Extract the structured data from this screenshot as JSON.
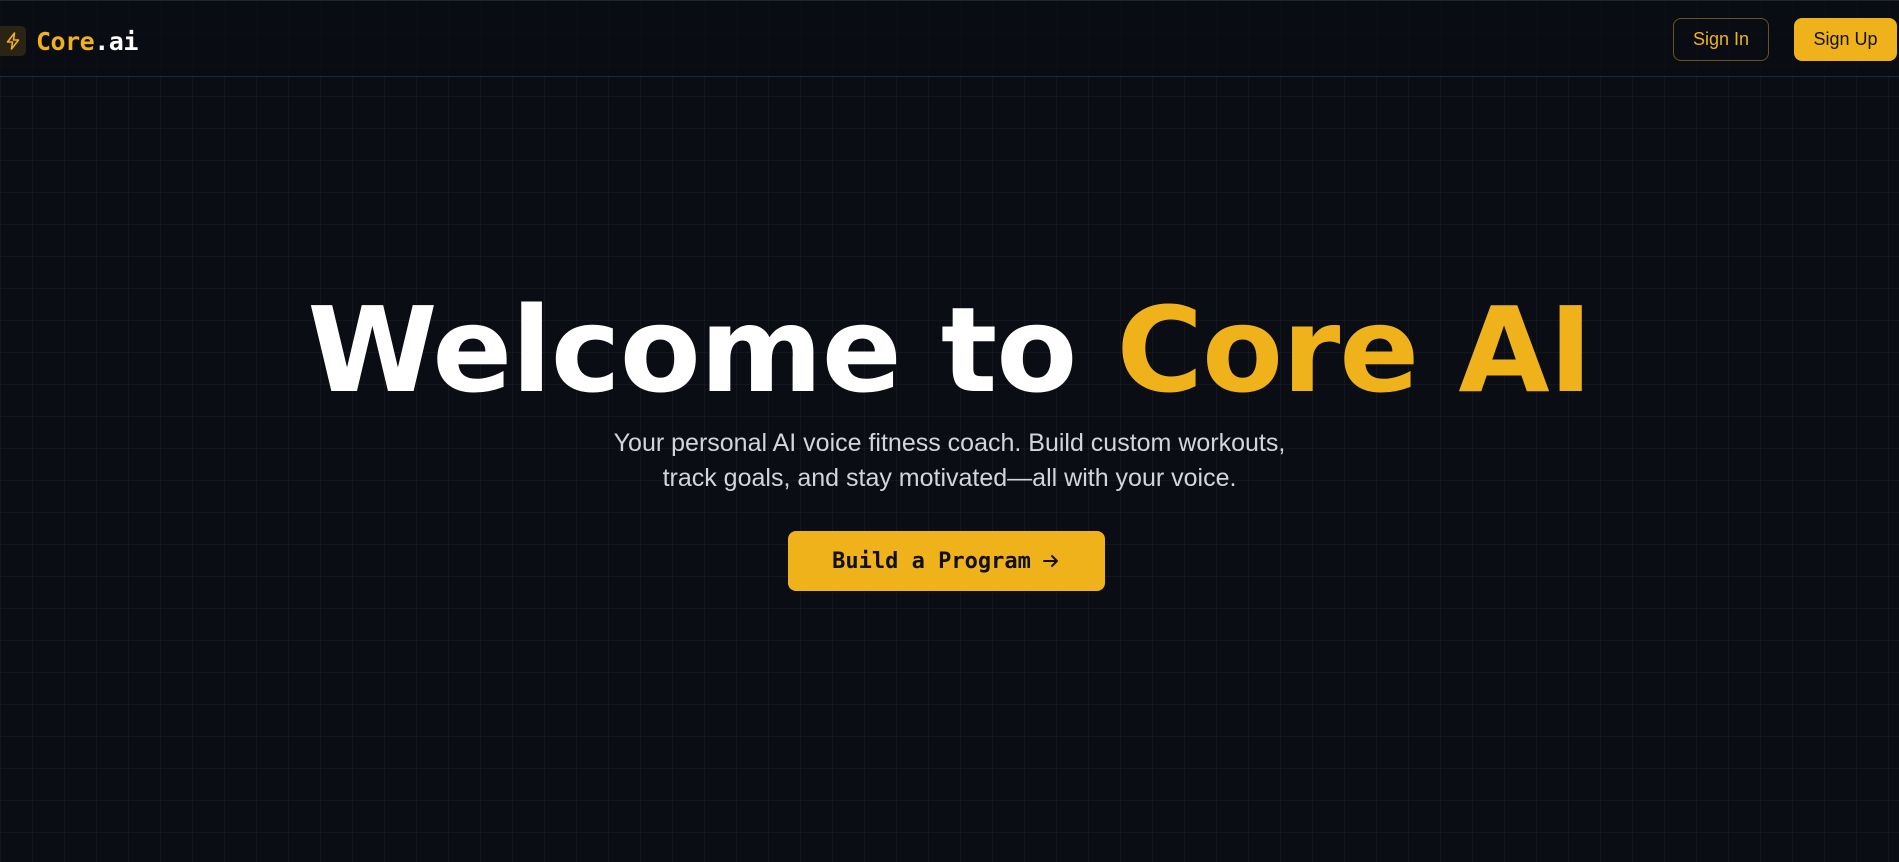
{
  "header": {
    "logo": {
      "icon": "lightning-bolt-icon",
      "brand_primary": "Core",
      "brand_suffix": ".ai"
    },
    "sign_in_label": "Sign In",
    "sign_up_label": "Sign Up"
  },
  "hero": {
    "title_prefix": "Welcome to",
    "title_highlight": "Core AI",
    "subtitle": "Your personal AI voice fitness coach. Build custom workouts, track goals, and stay motivated—all with your voice.",
    "cta_label": "Build a Program",
    "cta_icon": "arrow-right-icon"
  },
  "colors": {
    "accent": "#f0b21a",
    "background": "#0a0d14",
    "text_primary": "#ffffff",
    "text_secondary": "#d2d5db"
  }
}
